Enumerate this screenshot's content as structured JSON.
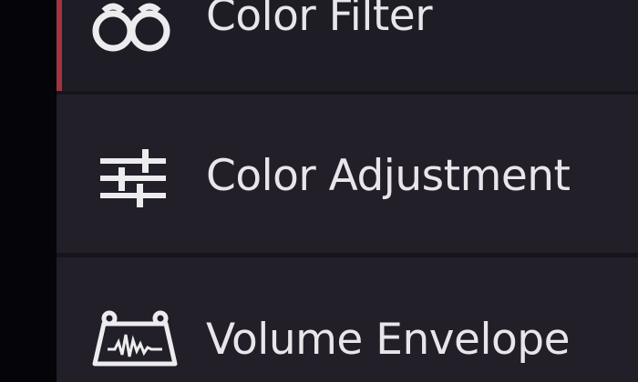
{
  "menu": {
    "items": [
      {
        "label": "Color Filter",
        "icon": "color-filter-icon",
        "active": true
      },
      {
        "label": "Color Adjustment",
        "icon": "sliders-icon",
        "active": false
      },
      {
        "label": "Volume Envelope",
        "icon": "volume-envelope-icon",
        "active": false
      }
    ]
  },
  "colors": {
    "background": "#211f28",
    "accent": "#a3343e",
    "text": "#e8e6ea"
  }
}
